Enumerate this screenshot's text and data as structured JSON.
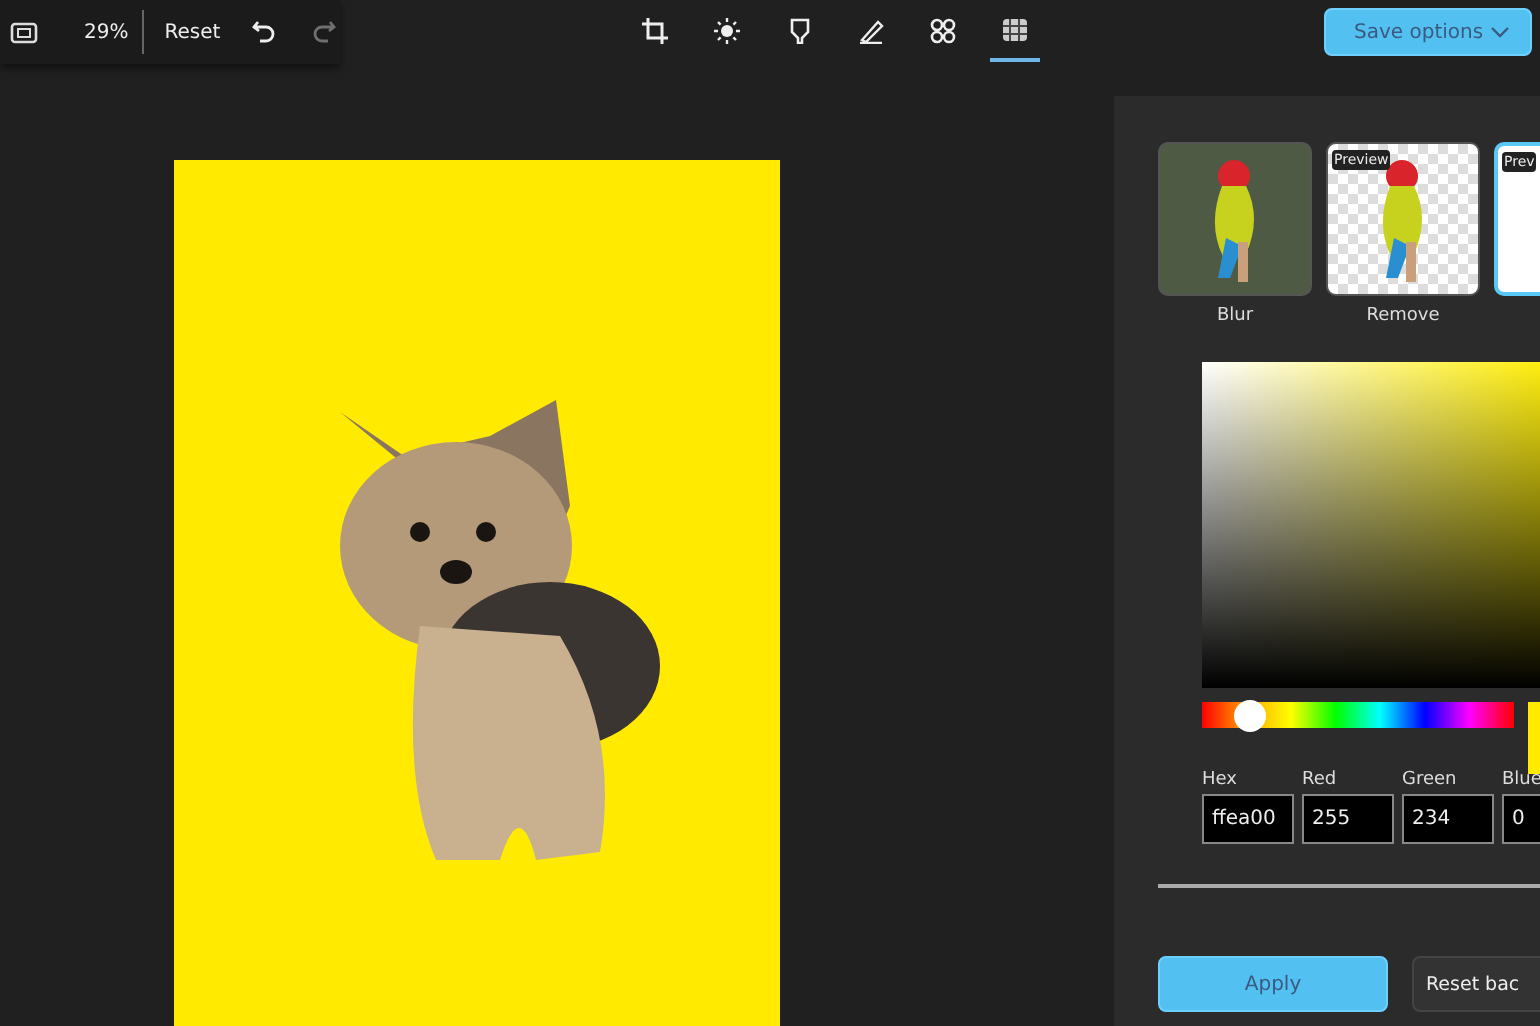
{
  "toolbar": {
    "zoom": "29%",
    "reset": "Reset",
    "undo_disabled": false,
    "redo_disabled": true
  },
  "tools": [
    {
      "kind": "crop",
      "selected": false
    },
    {
      "kind": "adjust",
      "selected": false
    },
    {
      "kind": "filter",
      "selected": false
    },
    {
      "kind": "markup",
      "selected": false
    },
    {
      "kind": "sticker",
      "selected": false
    },
    {
      "kind": "background",
      "selected": true
    }
  ],
  "save_button": "Save options",
  "effects": [
    {
      "kind": "blur",
      "label": "Blur",
      "selected": false
    },
    {
      "kind": "remove",
      "label": "Remove",
      "badge": "Preview",
      "selected": false
    },
    {
      "kind": "replace",
      "badge": "Prev",
      "selected": true
    }
  ],
  "color_picker": {
    "hue": {
      "level": 0.155
    },
    "fields": [
      {
        "label": "Hex",
        "value": "ffea00"
      },
      {
        "label": "Red",
        "value": "255"
      },
      {
        "label": "Green",
        "value": "234"
      },
      {
        "label": "Blue",
        "value": "0"
      }
    ]
  },
  "buttons": [
    {
      "label": "Apply",
      "kind": "primary"
    },
    {
      "label": "Reset bac",
      "kind": "secondary"
    }
  ]
}
